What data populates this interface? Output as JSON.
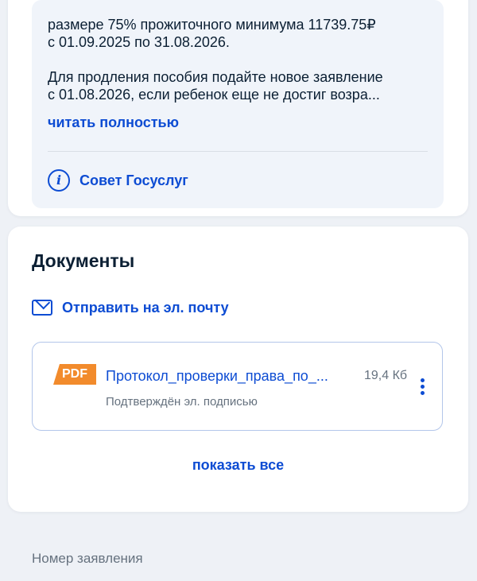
{
  "benefit_info": {
    "paragraph1_line1": "размере 75% прожиточного минимума 11739.75₽",
    "paragraph1_line2": "с 01.09.2025 по 31.08.2026.",
    "paragraph2_line1": "Для продления пособия подайте новое заявление",
    "paragraph2_line2": "с 01.08.2026, если ребенок еще не достиг возра...",
    "read_more_label": "читать полностью",
    "tip_label": "Совет Госуслуг",
    "tip_icon": "info-icon"
  },
  "documents": {
    "title": "Документы",
    "email_label": "Отправить на эл. почту",
    "email_icon": "mail-icon",
    "files": [
      {
        "type_badge": "PDF",
        "name": "Протокол_проверки_права_по_...",
        "size": "19,4 Кб",
        "subtitle": "Подтверждён эл. подписью"
      }
    ],
    "show_all_label": "показать все"
  },
  "application": {
    "number_label": "Номер заявления"
  },
  "colors": {
    "accent": "#0d4cd3",
    "pdf_badge": "#f28b2c",
    "text_primary": "#0b1f33",
    "text_secondary": "#66727f",
    "page_bg": "#eef1f6",
    "info_box_bg": "#f0f4fa"
  }
}
